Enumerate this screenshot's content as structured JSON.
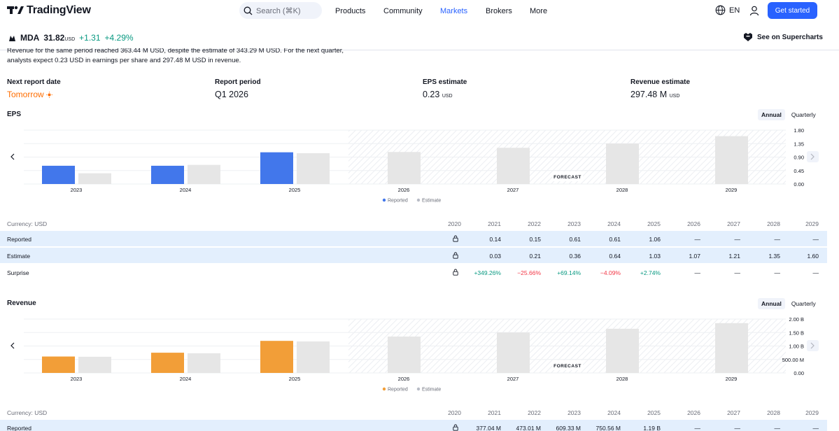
{
  "nav": {
    "logo_text": "TradingView",
    "search_placeholder": "Search (⌘K)",
    "items": [
      {
        "label": "Products",
        "active": false
      },
      {
        "label": "Community",
        "active": false
      },
      {
        "label": "Markets",
        "active": true
      },
      {
        "label": "Brokers",
        "active": false
      },
      {
        "label": "More",
        "active": false
      }
    ],
    "lang": "EN",
    "get_started": "Get started"
  },
  "symbol": {
    "ticker": "MDA",
    "price": "31.82",
    "currency": "USD",
    "change": "+1.31",
    "change_pct": "+4.29%",
    "supercharts": "See on Supercharts"
  },
  "summary": {
    "line1": "Revenue for the same period reached 363.44 M USD, despite the estimate of 343.29 M USD. For the next quarter,",
    "line2": "analysts expect 0.23 USD in earnings per share and 297.48 M USD in revenue."
  },
  "kpis": [
    {
      "label": "Next report date",
      "value": "Tomorrow",
      "unit": "",
      "accent": true
    },
    {
      "label": "Report period",
      "value": "Q1 2026",
      "unit": "",
      "accent": false
    },
    {
      "label": "EPS estimate",
      "value": "0.23",
      "unit": "USD",
      "accent": false
    },
    {
      "label": "Revenue estimate",
      "value": "297.48 M",
      "unit": "USD",
      "accent": false
    }
  ],
  "eps_section": {
    "title": "EPS",
    "toggle": [
      "Annual",
      "Quarterly"
    ]
  },
  "revenue_section": {
    "title": "Revenue",
    "toggle": [
      "Annual",
      "Quarterly"
    ]
  },
  "legend": {
    "reported": "Reported",
    "estimate": "Estimate"
  },
  "forecast_label": "FORECAST",
  "colors": {
    "eps_reported": "#4277eb",
    "rev_reported": "#f29e38",
    "estimate": "#e6e6e6",
    "accent": "#2962ff",
    "positive": "#089981",
    "negative": "#f23645"
  },
  "chart_data": [
    {
      "type": "bar",
      "title": "EPS",
      "categories": [
        "2023",
        "2024",
        "2025",
        "2026",
        "2027",
        "2028",
        "2029"
      ],
      "series": [
        {
          "name": "Reported",
          "values": [
            0.61,
            0.61,
            1.06,
            null,
            null,
            null,
            null
          ]
        },
        {
          "name": "Estimate",
          "values": [
            0.36,
            0.64,
            1.03,
            1.07,
            1.21,
            1.35,
            1.6
          ]
        }
      ],
      "y_ticks": [
        "1.80",
        "1.35",
        "0.90",
        "0.45",
        "0.00"
      ],
      "ylim": [
        0,
        1.8
      ],
      "forecast_from": "2026",
      "legend_position": "bottom-center"
    },
    {
      "type": "bar",
      "title": "Revenue",
      "categories": [
        "2023",
        "2024",
        "2025",
        "2026",
        "2027",
        "2028",
        "2029"
      ],
      "series": [
        {
          "name": "Reported",
          "values": [
            609330000,
            750560000,
            1190000000,
            null,
            null,
            null,
            null
          ]
        },
        {
          "name": "Estimate",
          "values": [
            600000000,
            730000000,
            1170000000,
            1350000000,
            1500000000,
            1640000000,
            1850000000
          ]
        }
      ],
      "y_ticks": [
        "2.00 B",
        "1.50 B",
        "1.00 B",
        "500.00 M",
        "0.00"
      ],
      "ylim": [
        0,
        2000000000
      ],
      "forecast_from": "2026",
      "legend_position": "bottom-center"
    }
  ],
  "eps_table": {
    "currency": "Currency: USD",
    "years": [
      "2020",
      "2021",
      "2022",
      "2023",
      "2024",
      "2025",
      "2026",
      "2027",
      "2028",
      "2029"
    ],
    "rows": [
      {
        "label": "Reported",
        "values": [
          "0.14",
          "0.15",
          "0.61",
          "0.61",
          "1.06",
          "—",
          "—",
          "—",
          "—"
        ]
      },
      {
        "label": "Estimate",
        "values": [
          "0.03",
          "0.21",
          "0.36",
          "0.64",
          "1.03",
          "1.07",
          "1.21",
          "1.35",
          "1.60"
        ]
      },
      {
        "label": "Surprise",
        "values": [
          "+349.26%",
          "−25.66%",
          "+69.14%",
          "−4.09%",
          "+2.74%",
          "—",
          "—",
          "—",
          "—"
        ]
      }
    ]
  },
  "revenue_table": {
    "currency": "Currency: USD",
    "years": [
      "2020",
      "2021",
      "2022",
      "2023",
      "2024",
      "2025",
      "2026",
      "2027",
      "2028",
      "2029"
    ],
    "rows": [
      {
        "label": "Reported",
        "values": [
          "377.04 M",
          "473.01 M",
          "609.33 M",
          "750.56 M",
          "1.19 B",
          "—",
          "—",
          "—",
          "—"
        ]
      }
    ]
  }
}
